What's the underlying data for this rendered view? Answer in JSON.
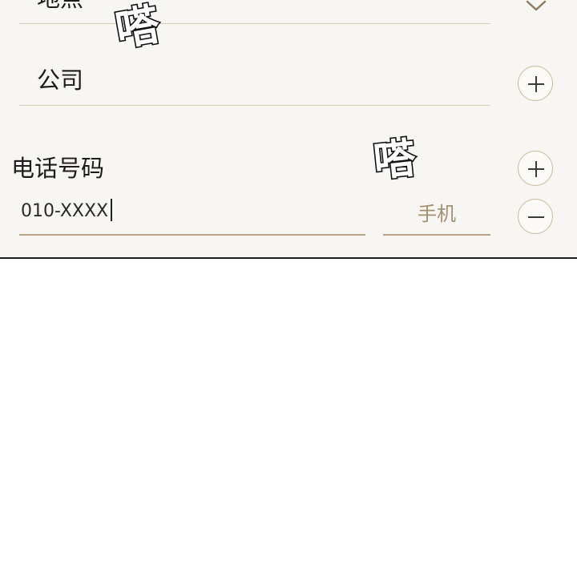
{
  "form": {
    "fields": {
      "top_partial_label": "地点",
      "company_label": "公司",
      "phone_label": "电话号码"
    },
    "phone": {
      "value": "010-XXXX",
      "type_label": "手机"
    }
  },
  "overlay": {
    "sound_effect": "嗒"
  },
  "icons": {
    "expand": "chevron-down-icon",
    "add": "plus-icon",
    "remove": "minus-icon"
  },
  "colors": {
    "panel_background": "#f7f6f3",
    "accent": "#a48f6e",
    "divider": "#d9ccb5"
  }
}
